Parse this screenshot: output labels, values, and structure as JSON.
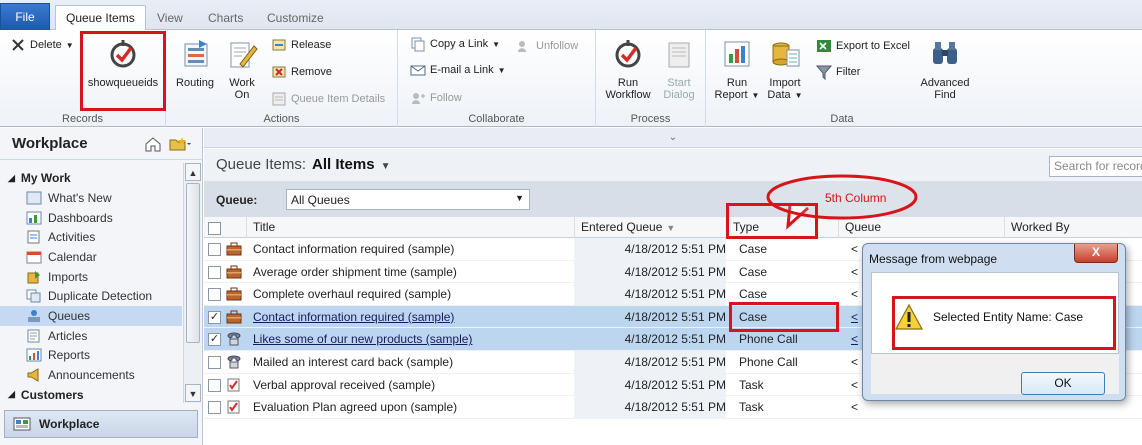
{
  "tabs": {
    "file": "File",
    "queue_items": "Queue Items",
    "view": "View",
    "charts": "Charts",
    "customize": "Customize"
  },
  "ribbon": {
    "delete": "Delete",
    "showqueueids": "showqueueids",
    "records_group": "Records",
    "routing": "Routing",
    "work_on": "Work On",
    "release": "Release",
    "remove": "Remove",
    "queue_item_details": "Queue Item Details",
    "actions_group": "Actions",
    "copy_link": "Copy a Link",
    "email_link": "E-mail a Link",
    "follow": "Follow",
    "unfollow": "Unfollow",
    "collaborate_group": "Collaborate",
    "run_workflow": "Run Workflow",
    "start_dialog": "Start Dialog",
    "process_group": "Process",
    "run_report": "Run Report",
    "import_data": "Import Data",
    "export_excel": "Export to Excel",
    "filter": "Filter",
    "advanced_find": "Advanced Find",
    "data_group": "Data"
  },
  "nav": {
    "title": "Workplace",
    "section_my_work": "My Work",
    "items": [
      "What's New",
      "Dashboards",
      "Activities",
      "Calendar",
      "Imports",
      "Duplicate Detection",
      "Queues",
      "Articles",
      "Reports",
      "Announcements"
    ],
    "section_customers": "Customers",
    "bottom_button": "Workplace"
  },
  "view": {
    "prefix": "Queue Items:",
    "name": "All Items",
    "search_placeholder": "Search for records",
    "queue_label": "Queue:",
    "queue_value": "All Queues"
  },
  "grid": {
    "columns": [
      "Title",
      "Entered Queue",
      "Type",
      "Queue",
      "Worked By"
    ],
    "rows": [
      {
        "title": "Contact information required (sample)",
        "entered": "4/18/2012 5:51 PM",
        "type": "Case",
        "queue": "<",
        "checked": false,
        "selected": false
      },
      {
        "title": "Average order shipment time (sample)",
        "entered": "4/18/2012 5:51 PM",
        "type": "Case",
        "queue": "<",
        "checked": false,
        "selected": false
      },
      {
        "title": "Complete overhaul required (sample)",
        "entered": "4/18/2012 5:51 PM",
        "type": "Case",
        "queue": "<",
        "checked": false,
        "selected": false
      },
      {
        "title": "Contact information required (sample)",
        "entered": "4/18/2012 5:51 PM",
        "type": "Case",
        "queue": "<",
        "checked": true,
        "selected": true
      },
      {
        "title": "Likes some of our new products (sample)",
        "entered": "4/18/2012 5:51 PM",
        "type": "Phone Call",
        "queue": "<",
        "checked": true,
        "selected": true
      },
      {
        "title": "Mailed an interest card back (sample)",
        "entered": "4/18/2012 5:51 PM",
        "type": "Phone Call",
        "queue": "<",
        "checked": false,
        "selected": false
      },
      {
        "title": "Verbal approval received (sample)",
        "entered": "4/18/2012 5:51 PM",
        "type": "Task",
        "queue": "<",
        "checked": false,
        "selected": false
      },
      {
        "title": "Evaluation Plan agreed upon (sample)",
        "entered": "4/18/2012 5:51 PM",
        "type": "Task",
        "queue": "<",
        "checked": false,
        "selected": false
      }
    ]
  },
  "annotation": {
    "callout": "5th Column"
  },
  "dialog": {
    "title": "Message from webpage",
    "close": "X",
    "message": "Selected Entity Name: Case",
    "ok": "OK"
  },
  "colors": {
    "highlight": "#d7141a",
    "selected_row": "#bcd6f0",
    "file_tab": "#2a67be"
  }
}
